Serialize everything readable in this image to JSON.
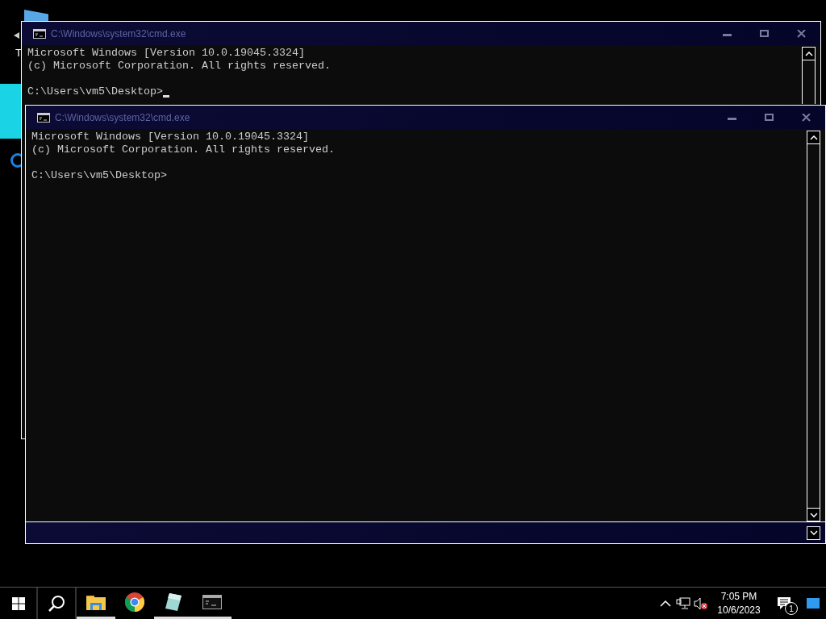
{
  "desktop_icons": [
    {
      "label": "T"
    }
  ],
  "windows": [
    {
      "title": "C:\\Windows\\system32\\cmd.exe",
      "banner": [
        "Microsoft Windows [Version 10.0.19045.3324]",
        "(c) Microsoft Corporation. All rights reserved."
      ],
      "prompt": "C:\\Users\\vm5\\Desktop>",
      "cursor": true
    },
    {
      "title": "C:\\Windows\\system32\\cmd.exe",
      "banner": [
        "Microsoft Windows [Version 10.0.19045.3324]",
        "(c) Microsoft Corporation. All rights reserved."
      ],
      "prompt": "C:\\Users\\vm5\\Desktop>",
      "cursor": false
    }
  ],
  "taskbar": {
    "apps": [
      {
        "kind": "explorer",
        "running": true
      },
      {
        "kind": "chrome",
        "running": false
      },
      {
        "kind": "notes",
        "running": true
      },
      {
        "kind": "terminal",
        "running": true
      }
    ],
    "time": "7:05 PM",
    "date": "10/6/2023",
    "notifications": "1"
  }
}
